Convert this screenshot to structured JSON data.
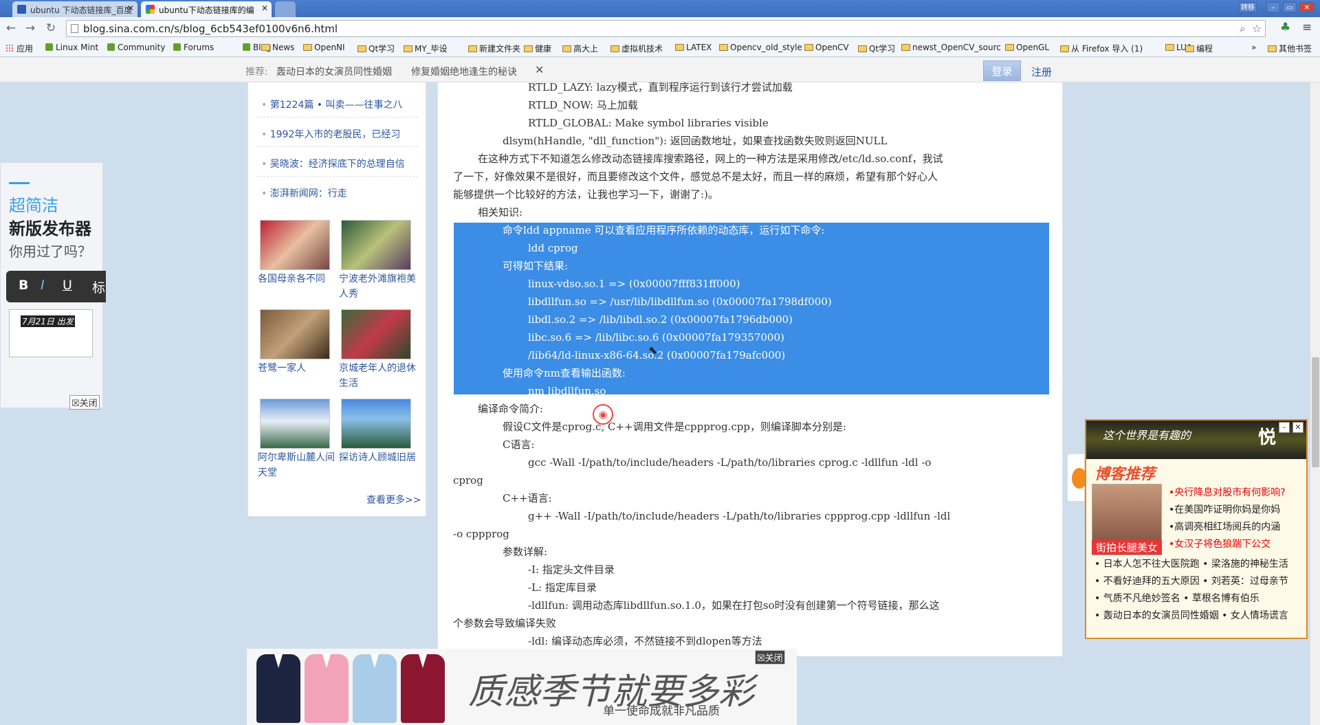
{
  "browser": {
    "tabs": [
      {
        "title": "ubuntu 下动态链接库_百度"
      },
      {
        "title": "ubuntu下动态链接库的编"
      }
    ],
    "window_buttons": [
      "转移",
      "–",
      "▭",
      "✕"
    ],
    "url": "blog.sina.com.cn/s/blog_6cb543ef0100v6n6.html",
    "bookmarks": [
      {
        "label": "应用",
        "icon": "apps-icon"
      },
      {
        "label": "Linux Mint",
        "icon": "mint-icon"
      },
      {
        "label": "Community",
        "icon": "mint-icon"
      },
      {
        "label": "Forums",
        "icon": "mint-icon"
      },
      {
        "label": "Blog",
        "icon": "mint-icon"
      },
      {
        "label": "News",
        "icon": "folder-icon"
      },
      {
        "label": "OpenNI",
        "icon": "folder-icon"
      },
      {
        "label": "Qt学习",
        "icon": "folder-icon"
      },
      {
        "label": "MY_毕设",
        "icon": "folder-icon"
      },
      {
        "label": "新建文件夹",
        "icon": "folder-icon"
      },
      {
        "label": "健康",
        "icon": "folder-icon"
      },
      {
        "label": "高大上",
        "icon": "folder-icon"
      },
      {
        "label": "虚拟机技术",
        "icon": "folder-icon"
      },
      {
        "label": "LATEX",
        "icon": "folder-icon"
      },
      {
        "label": "Opencv_old_style",
        "icon": "folder-icon"
      },
      {
        "label": "OpenCV",
        "icon": "folder-icon"
      },
      {
        "label": "Qt学习",
        "icon": "folder-icon"
      },
      {
        "label": "newst_OpenCV_sourc",
        "icon": "folder-icon"
      },
      {
        "label": "OpenGL",
        "icon": "folder-icon"
      },
      {
        "label": "从 Firefox 导入 (1)",
        "icon": "folder-icon"
      },
      {
        "label": "LUA",
        "icon": "folder-icon"
      },
      {
        "label": "编程",
        "icon": "folder-icon"
      }
    ],
    "bookmarks_overflow": "»",
    "other_bookmarks": "其他书签"
  },
  "sinabar": {
    "label": "推荐:",
    "items": [
      "轰动日本的女演员同性婚姻",
      "修复婚姻绝地逢生的秘诀"
    ],
    "close": "✕",
    "login": "登录",
    "register": "注册"
  },
  "sidebar": {
    "links": [
      "第1224篇 • 叫卖——往事之八",
      "1992年入市的老股民，已经习",
      "吴晓波：经济探底下的总理自信",
      "澎湃新闻网：行走"
    ],
    "thumbs": [
      {
        "caption": "各国母亲各不同"
      },
      {
        "caption": "宁波老外滩旗袍美人秀"
      },
      {
        "caption": "苍鹭一家人"
      },
      {
        "caption": "京城老年人的退休生活"
      },
      {
        "caption": "阿尔卑斯山麓人间天堂"
      },
      {
        "caption": "探访诗人顾城旧居"
      }
    ],
    "more": "查看更多>>"
  },
  "article": {
    "lines": [
      "RTLD_LAZY: lazy模式，直到程序运行到该行才尝试加载",
      "RTLD_NOW: 马上加载",
      "RTLD_GLOBAL: Make symbol libraries visible",
      "dlsym(hHandle, \"dll_function\"): 返回函数地址，如果查找函数失败则返回NULL",
      "在这种方式下不知道怎么修改动态链接库搜索路径，网上的一种方法是采用修改/etc/ld.so.conf，我试",
      "了一下，好像效果不是很好，而且要修改这个文件，感觉总不是太好，而且一样的麻烦，希望有那个好心人",
      "能够提供一个比较好的方法，让我也学习一下，谢谢了:)。",
      "相关知识:",
      "命令ldd appname 可以查看应用程序所依赖的动态库，运行如下命令:",
      "ldd cprog",
      "可得如下结果:",
      "linux-vdso.so.1 => (0x00007fff831ff000)",
      "libdllfun.so => /usr/lib/libdllfun.so (0x00007fa1798df000)",
      "libdl.so.2 => /lib/libdl.so.2 (0x00007fa1796db000)",
      "libc.so.6 => /lib/libc.so.6 (0x00007fa179357000)",
      "/lib64/ld-linux-x86-64.so.2 (0x00007fa179afc000)",
      "使用命令nm查看输出函数:",
      "nm libdllfun.so",
      "编译命令简介:",
      "假设C文件是cprog.c, C++调用文件是cppprog.cpp，则编译脚本分别是:",
      "C语言:",
      "gcc -Wall -I/path/to/include/headers -L/path/to/libraries cprog.c -ldllfun -ldl -o",
      "cprog",
      "C++语言:",
      "g++ -Wall -I/path/to/include/headers -L/path/to/libraries cppprog.cpp -ldllfun -ldl",
      "-o cppprog",
      "参数详解:",
      "-I: 指定头文件目录",
      "-L: 指定库目录",
      "-ldllfun: 调用动态库libdllfun.so.1.0，如果在打包so时没有创建第一个符号链接，那么这",
      "个参数会导致编译失败",
      "-ldl: 编译动态库必须，不然链接不到dlopen等方法"
    ]
  },
  "left_ad": {
    "line1": "超简洁",
    "line2": "新版发布器",
    "line3": "你用过了吗？",
    "toolbar": [
      "B",
      "I",
      "U",
      "标"
    ],
    "date": "7月21日 出发",
    "close": "☒关闭"
  },
  "right_ad": {
    "banner": "这个世界是有趣的",
    "banner_big": "悦",
    "title": "博客推荐",
    "photo_caption": "街拍长腿美女",
    "red_links": [
      {
        "text": "•央行降息对股市有何影响?",
        "color": "#e60000"
      },
      {
        "text": "•在美国咋证明你妈是你妈",
        "color": "#222222"
      },
      {
        "text": "•高调亮相红场阅兵的内涵",
        "color": "#222222"
      },
      {
        "text": "•女汉子将色狼踹下公交",
        "color": "#e60000"
      }
    ],
    "links": [
      "• 日本人怎不往大医院跑 • 梁洛施的神秘生活",
      "• 不看好迪拜的五大原因 • 刘若英：过母亲节",
      "• 气质不凡绝妙签名 • 草根名博有伯乐",
      "• 轰动日本的女演员同性婚姻 • 女人情场谎言"
    ]
  },
  "bottom_ad": {
    "slogan": "质感季节就要多彩",
    "sub": "单一使命成就非凡品质",
    "close": "☒关闭",
    "shirt_colors": [
      "#1d2440",
      "#f2a3b9",
      "#a9cde9",
      "#8c1630"
    ]
  }
}
